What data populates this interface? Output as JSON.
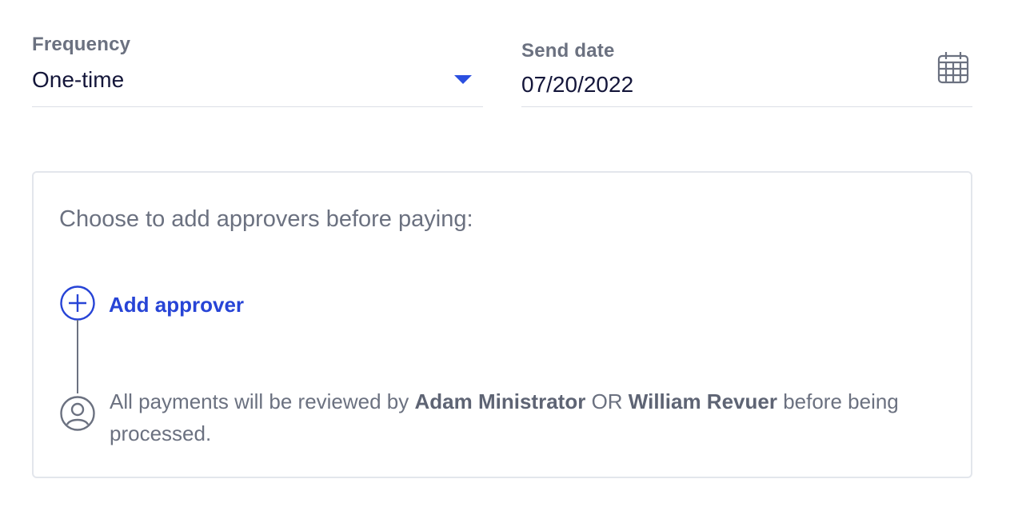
{
  "frequency": {
    "label": "Frequency",
    "value": "One-time"
  },
  "send_date": {
    "label": "Send date",
    "value": "07/20/2022"
  },
  "approvers": {
    "title": "Choose to add approvers before paying:",
    "add_label": "Add approver",
    "review_prefix": "All payments will be reviewed by",
    "approver_1": "Adam Ministrator",
    "conjunction": "OR",
    "approver_2": "William Revuer",
    "review_suffix": "before being processed."
  },
  "colors": {
    "accent": "#2744d6",
    "text_muted": "#6b7180",
    "text_dark": "#14163a",
    "border": "#e3e6ec"
  },
  "icons": [
    "dropdown-caret-icon",
    "calendar-icon",
    "plus-circle-icon",
    "user-circle-icon"
  ]
}
